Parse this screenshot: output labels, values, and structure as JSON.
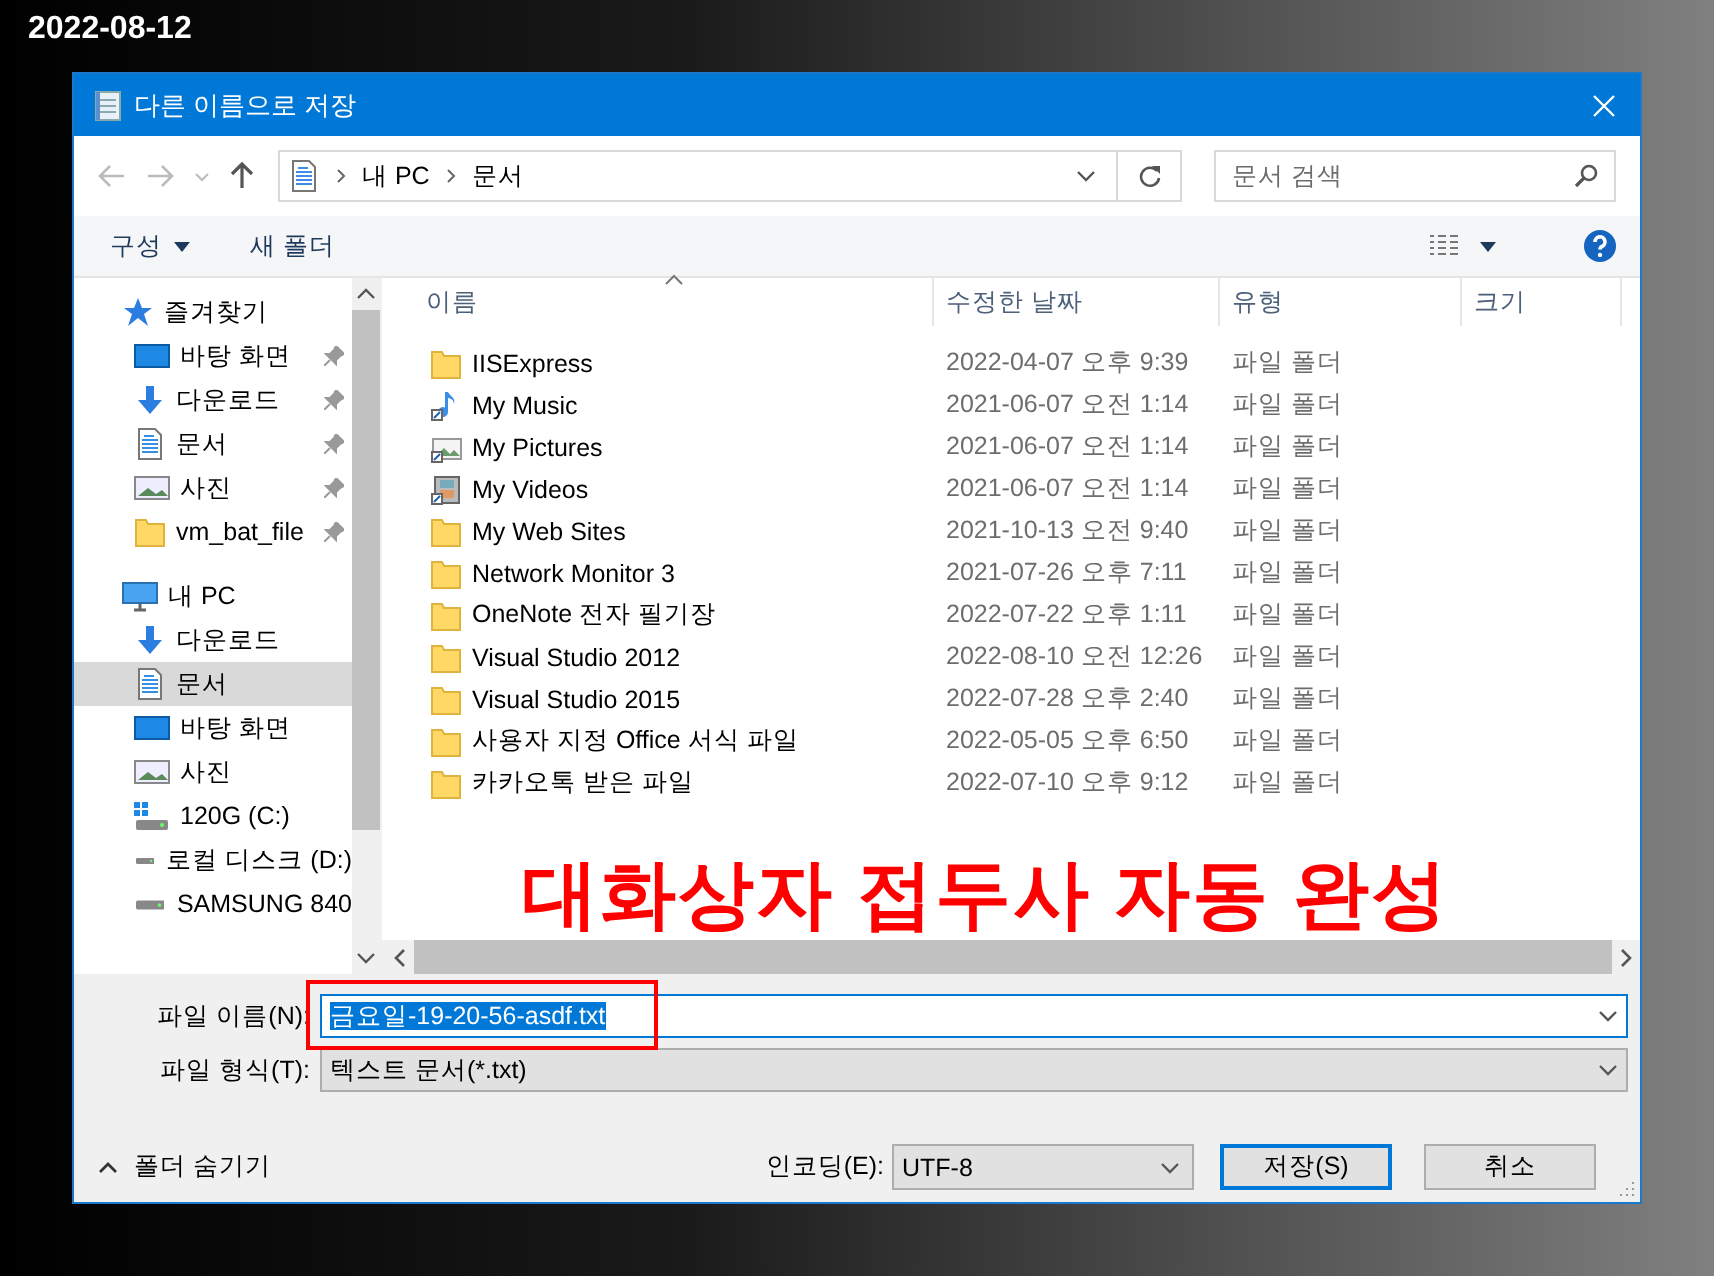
{
  "date": "2022-08-12",
  "window": {
    "title": "다른 이름으로 저장"
  },
  "address": {
    "path": [
      {
        "label": "내 PC"
      },
      {
        "label": "문서"
      }
    ]
  },
  "search": {
    "placeholder": "문서 검색"
  },
  "toolbar": {
    "organize": "구성",
    "new_folder": "새 폴더"
  },
  "sidebar": {
    "sections": [
      {
        "label": "즐겨찾기",
        "kind": "star",
        "selected": false,
        "items": [
          {
            "label": "바탕 화면",
            "kind": "desktop",
            "pinned": true,
            "selected": false
          },
          {
            "label": "다운로드",
            "kind": "download",
            "pinned": true,
            "selected": false
          },
          {
            "label": "문서",
            "kind": "document",
            "pinned": true,
            "selected": false
          },
          {
            "label": "사진",
            "kind": "picture",
            "pinned": true,
            "selected": false
          },
          {
            "label": "vm_bat_file",
            "kind": "folder",
            "pinned": true,
            "selected": false
          }
        ]
      },
      {
        "label": "내 PC",
        "kind": "pc",
        "selected": false,
        "items": [
          {
            "label": "다운로드",
            "kind": "download",
            "pinned": false,
            "selected": false
          },
          {
            "label": "문서",
            "kind": "document",
            "pinned": false,
            "selected": true
          },
          {
            "label": "바탕 화면",
            "kind": "desktop",
            "pinned": false,
            "selected": false
          },
          {
            "label": "사진",
            "kind": "picture",
            "pinned": false,
            "selected": false
          },
          {
            "label": "120G (C:)",
            "kind": "system-drive",
            "pinned": false,
            "selected": false
          },
          {
            "label": "로컬 디스크 (D:)",
            "kind": "drive",
            "pinned": false,
            "selected": false
          },
          {
            "label": "SAMSUNG 840",
            "kind": "drive",
            "pinned": false,
            "selected": false
          }
        ]
      }
    ]
  },
  "columns": [
    {
      "label": "이름",
      "sorted": true
    },
    {
      "label": "수정한 날짜",
      "sorted": false
    },
    {
      "label": "유형",
      "sorted": false
    },
    {
      "label": "크기",
      "sorted": false
    }
  ],
  "files": [
    {
      "name": "IISExpress",
      "modified": "2022-04-07 오후 9:39",
      "type": "파일 폴더",
      "kind": "folder"
    },
    {
      "name": "My Music",
      "modified": "2021-06-07 오전 1:14",
      "type": "파일 폴더",
      "kind": "music"
    },
    {
      "name": "My Pictures",
      "modified": "2021-06-07 오전 1:14",
      "type": "파일 폴더",
      "kind": "pictures"
    },
    {
      "name": "My Videos",
      "modified": "2021-06-07 오전 1:14",
      "type": "파일 폴더",
      "kind": "videos"
    },
    {
      "name": "My Web Sites",
      "modified": "2021-10-13 오전 9:40",
      "type": "파일 폴더",
      "kind": "folder"
    },
    {
      "name": "Network Monitor 3",
      "modified": "2021-07-26 오후 7:11",
      "type": "파일 폴더",
      "kind": "folder"
    },
    {
      "name": "OneNote 전자 필기장",
      "modified": "2022-07-22 오후 1:11",
      "type": "파일 폴더",
      "kind": "folder"
    },
    {
      "name": "Visual Studio 2012",
      "modified": "2022-08-10 오전 12:26",
      "type": "파일 폴더",
      "kind": "folder"
    },
    {
      "name": "Visual Studio 2015",
      "modified": "2022-07-28 오후 2:40",
      "type": "파일 폴더",
      "kind": "folder"
    },
    {
      "name": "사용자 지정 Office 서식 파일",
      "modified": "2022-05-05 오후 6:50",
      "type": "파일 폴더",
      "kind": "folder"
    },
    {
      "name": "카카오톡 받은 파일",
      "modified": "2022-07-10 오후 9:12",
      "type": "파일 폴더",
      "kind": "folder"
    }
  ],
  "filename": {
    "label": "파일 이름(N):",
    "value": "금요일-19-20-56-asdf.txt",
    "text_selected": true
  },
  "filetype": {
    "label": "파일 형식(T):",
    "value": "텍스트 문서(*.txt)"
  },
  "hide_folders": "폴더 숨기기",
  "encoding": {
    "label": "인코딩(E):",
    "value": "UTF-8"
  },
  "buttons": [
    {
      "label": "저장(S)",
      "default": true
    },
    {
      "label": "취소",
      "default": false
    }
  ],
  "annotation": {
    "text": "대화상자 접두사 자동 완성"
  }
}
